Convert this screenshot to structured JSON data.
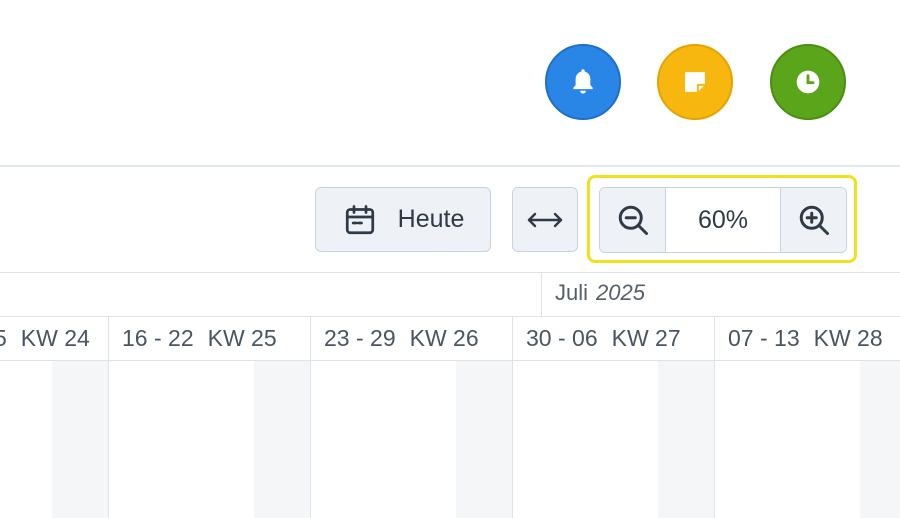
{
  "header_buttons": {
    "notifications_icon": "bell-icon",
    "notes_icon": "sticky-note-icon",
    "time_icon": "clock-icon",
    "colors": {
      "notifications": "#2a86e6",
      "notes": "#f7b70f",
      "time": "#5aa51a"
    }
  },
  "toolbar": {
    "today_label": "Heute",
    "today_icon": "calendar-icon",
    "fit_icon": "horizontal-arrows-icon",
    "zoom_out_icon": "zoom-out-icon",
    "zoom_in_icon": "zoom-in-icon",
    "zoom_value": "60%",
    "highlight_color": "#f1e11c"
  },
  "timeline": {
    "month": "Juli",
    "year": "2025",
    "weeks": [
      {
        "range": "5",
        "kw": "KW 24"
      },
      {
        "range": "16 - 22",
        "kw": "KW 25"
      },
      {
        "range": "23 - 29",
        "kw": "KW 26"
      },
      {
        "range": "30 - 06",
        "kw": "KW 27"
      },
      {
        "range": "07 - 13",
        "kw": "KW 28"
      }
    ]
  }
}
